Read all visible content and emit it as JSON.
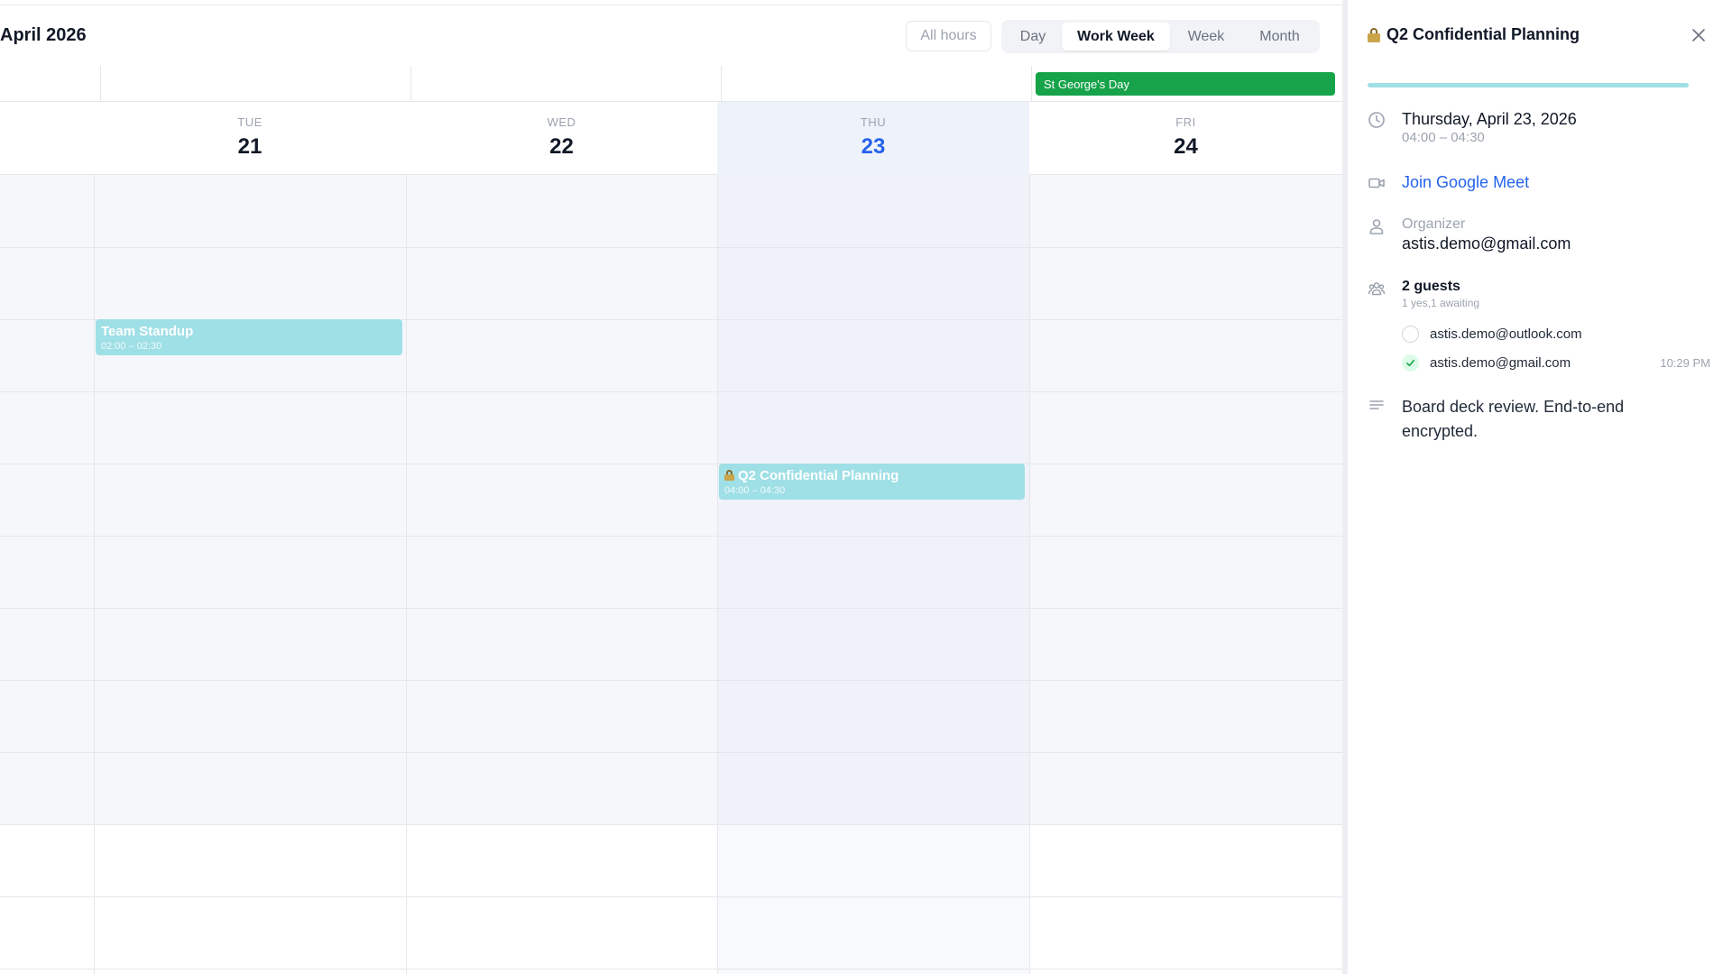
{
  "header": {
    "month_title": "April 2026",
    "all_hours_label": "All hours",
    "views": [
      {
        "label": "Day",
        "active": false
      },
      {
        "label": "Work Week",
        "active": true
      },
      {
        "label": "Week",
        "active": false
      },
      {
        "label": "Month",
        "active": false
      }
    ]
  },
  "all_day_events": [
    {
      "title": "St George's Day",
      "day": "FRI",
      "color": "#16a34a"
    }
  ],
  "days": [
    {
      "dow": "TUE",
      "num": "21",
      "today": false
    },
    {
      "dow": "WED",
      "num": "22",
      "today": false
    },
    {
      "dow": "THU",
      "num": "23",
      "today": true
    },
    {
      "dow": "FRI",
      "num": "24",
      "today": false
    }
  ],
  "events": [
    {
      "title": "Team Standup",
      "time": "02:00 – 02:30",
      "day": "TUE",
      "locked": false,
      "color": "#9fdfe6"
    },
    {
      "title": "Q2 Confidential Planning",
      "time": "04:00 – 04:30",
      "day": "THU",
      "locked": true,
      "color": "#9fdfe6"
    }
  ],
  "panel": {
    "title": "Q2 Confidential Planning",
    "accent_color": "#9fdfe6",
    "date": "Thursday, April 23, 2026",
    "time": "04:00 – 04:30",
    "meet_label": "Join Google Meet",
    "organizer_label": "Organizer",
    "organizer_email": "astis.demo@gmail.com",
    "guests_title": "2 guests",
    "guests_sub": "1 yes,1 awaiting",
    "guests": [
      {
        "email": "astis.demo@outlook.com",
        "status": "pending",
        "time": ""
      },
      {
        "email": "astis.demo@gmail.com",
        "status": "yes",
        "time": "10:29 PM"
      }
    ],
    "description": "Board deck review. End-to-end encrypted."
  },
  "colors": {
    "today_accent": "#2563eb",
    "holiday": "#16a34a",
    "event": "#9fdfe6"
  }
}
